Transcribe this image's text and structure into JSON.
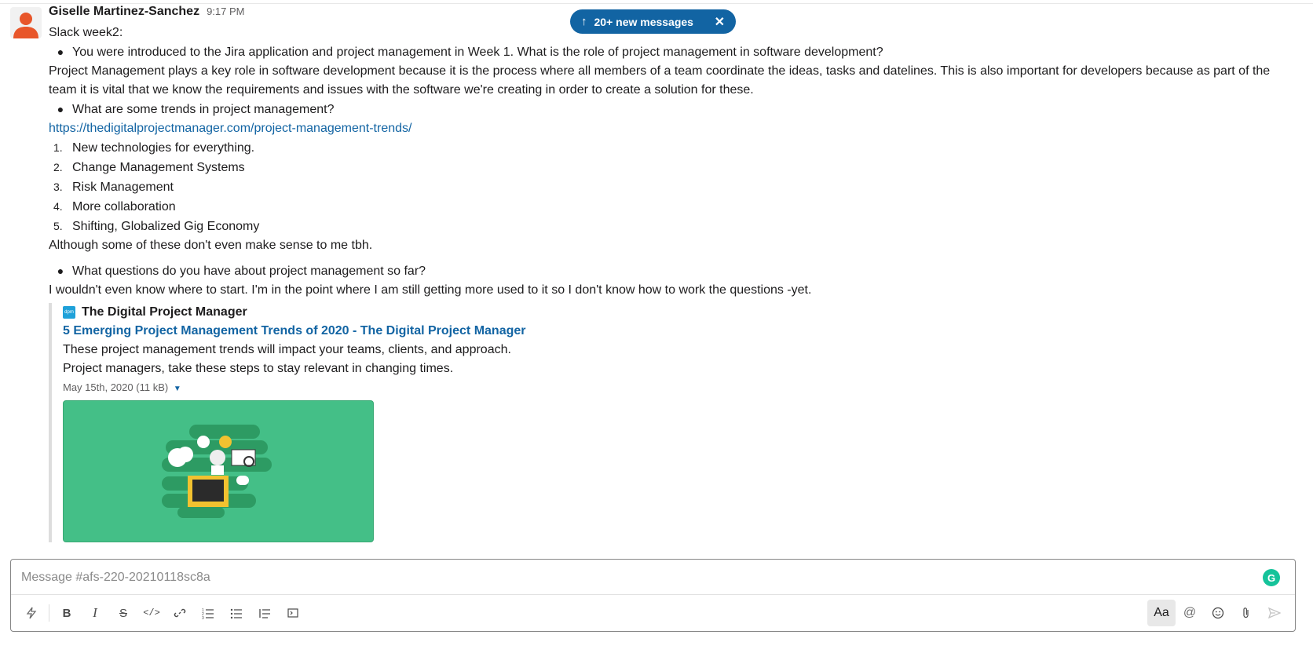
{
  "banner": {
    "label": "20+ new messages"
  },
  "message": {
    "author": "Giselle Martinez-Sanchez",
    "time": "9:17 PM",
    "lines": {
      "intro": "Slack week2:",
      "q1": "You were introduced to the Jira application and project management in Week 1. What is the role of project management in software development?",
      "a1": "Project Management plays a key role in software development because it is the process where all members of a team coordinate the ideas, tasks and datelines. This is also important for developers because as part of the team it is vital that we know the requirements and issues with the software we're creating in order to create a solution for these.",
      "q2": "What are some trends in project management?",
      "link": "https://thedigitalprojectmanager.com/project-management-trends/",
      "trends": [
        "New technologies for everything.",
        "Change Management Systems",
        "Risk Management",
        "More collaboration",
        "Shifting, Globalized Gig Economy"
      ],
      "a2": "Although some of these don't even make sense to me tbh.",
      "q3": "What questions do you have about project management so far?",
      "a3": "I wouldn't even know where to start. I'm in the point where I am still getting more used to it so I don't know how to work the questions -yet."
    },
    "unfurl": {
      "site_icon_text": "dpm",
      "site_name": "The Digital Project Manager",
      "title": "5 Emerging Project Management Trends of 2020 - The Digital Project Manager",
      "desc1": "These project management trends will impact your teams, clients, and approach.",
      "desc2": "Project managers, take these steps to stay relevant in changing times.",
      "date": "May 15th, 2020",
      "size": "11 kB"
    }
  },
  "composer": {
    "placeholder": "Message #afs-220-20210118sc8a",
    "grammarly": "G",
    "aa_label": "Aa"
  },
  "colors": {
    "accent": "#1264a3",
    "thumb_bg": "#44bf87",
    "avatar": "#e8562a"
  }
}
